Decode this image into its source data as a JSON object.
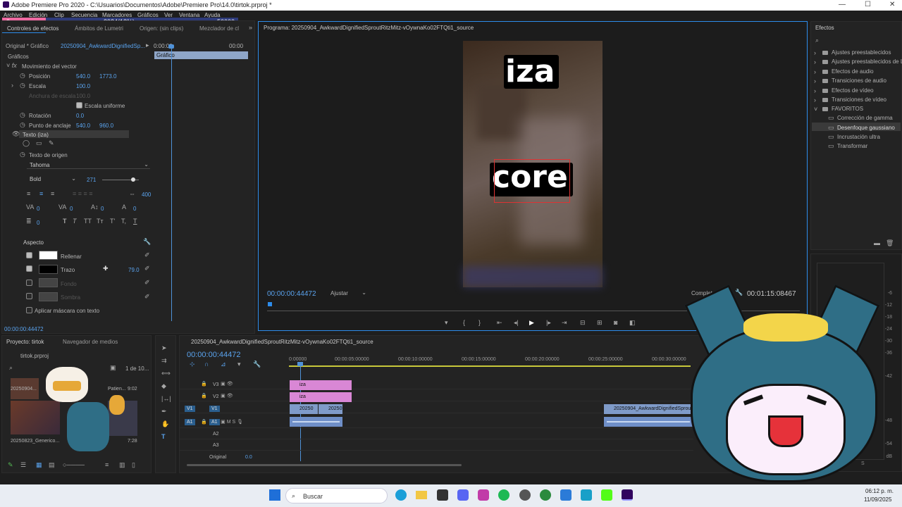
{
  "window": {
    "title": "Adobe Premiere Pro 2020 - C:\\Usuarios\\Documentos\\Adobe\\Premiere Pro\\14.0\\tirtok.prproj *"
  },
  "overlay": {
    "left_value": "0",
    "mid_value": "8984(18%)",
    "right_value": "50000"
  },
  "menu": [
    "Archivo",
    "Edición",
    "Clip",
    "Secuencia",
    "Marcadores",
    "Gráficos",
    "Ver",
    "Ventana",
    "Ayuda"
  ],
  "effect_controls": {
    "tabs": [
      "Controles de efectos",
      "Ámbitos de Lumetri",
      "Origen: (sin clips)",
      "Mezclador de cl"
    ],
    "source": "Original * Gráfico",
    "sequence": "20250904_AwkwardDignifiedSp...",
    "timecode_start": "0:00:00",
    "timecode_end": "00:00",
    "clip_label": "Gráfico",
    "section": "Gráficos",
    "vector_motion": "Movimiento del vector",
    "position_label": "Posición",
    "position_x": "540.0",
    "position_y": "1773.0",
    "scale_label": "Escala",
    "scale_value": "100.0",
    "scale_width_label": "Anchura de escala",
    "scale_width_value": "100.0",
    "uniform_scale": "Escala uniforme",
    "rotation_label": "Rotación",
    "rotation_value": "0.0",
    "anchor_label": "Punto de anclaje",
    "anchor_x": "540.0",
    "anchor_y": "960.0",
    "text_layer": "Texto (iza)",
    "source_text": "Texto de origen",
    "font": "Tahoma",
    "font_style": "Bold",
    "font_size": "271",
    "tracking_value": "400",
    "kerning": [
      "0",
      "0",
      "0",
      "0",
      "0"
    ],
    "text_styles": [
      "T",
      "T",
      "TT",
      "Tт",
      "T'",
      "T,",
      "T"
    ],
    "appearance": "Aspecto",
    "fill_label": "Rellenar",
    "stroke_label": "Trazo",
    "stroke_value": "79.0",
    "background_label": "Fondo",
    "shadow_label": "Sombra",
    "mask_label": "Aplicar máscara con texto",
    "footer_timecode": "00:00:00:44472"
  },
  "program": {
    "title": "Programa: 20250904_AwkwardDignifiedSproutRitzMitz-vOywnaKo02FTQti1_source",
    "text_top": "iza",
    "text_bottom": "core",
    "timecode_left": "00:00:00:44472",
    "fit": "Ajustar",
    "quality": "Completa",
    "timecode_right": "00:01:15:08467"
  },
  "project": {
    "tab_project": "Proyecto: tirtok",
    "tab_media": "Navegador de medios",
    "file": "tirtok.prproj",
    "count": "1 de 10...",
    "item1": "20250904...",
    "item1_meta": "Patien...",
    "item1_dur": "9:02",
    "item2": "20250823_Generico...",
    "item2_dur": "7:28"
  },
  "timeline": {
    "title": "20250904_AwkwardDignifiedSproutRitzMitz-vOywnaKo02FTQti1_source",
    "timecode": "00:00:00:44472",
    "ruler": [
      "0:00000",
      "00:00:05:00000",
      "00:00:10:00000",
      "00:00:15:00000",
      "00:00:20:00000",
      "00:00:25:00000",
      "00:00:30:00000"
    ],
    "tracks": [
      "V3",
      "V2",
      "V1",
      "A1",
      "A2",
      "A3"
    ],
    "src_v1": "V1",
    "src_a1": "A1",
    "clips": {
      "v3": "iza",
      "v2": "iza",
      "v1a": "20250",
      "v1b": "20250",
      "v1c": "20250904_AwkwardDignifiedSprout",
      "a1": ""
    },
    "original": "Original",
    "original_value": "0.0"
  },
  "effects": {
    "title": "Efectos",
    "items": [
      "Ajustes preestablecidos",
      "Ajustes preestablecidos de L",
      "Efectos de audio",
      "Transiciones de audio",
      "Efectos de vídeo",
      "Transiciones de vídeo",
      "FAVORITOS"
    ],
    "favorites": [
      "Corrección de gamma",
      "Desenfoque gaussiano",
      "Incrustación ultra",
      "Transformar"
    ]
  },
  "meters": [
    "-6",
    "-12",
    "-18",
    "-24",
    "-30",
    "-36",
    "-42",
    "-48",
    "-54",
    "dB"
  ],
  "meter_footer": [
    "S",
    "S"
  ],
  "taskbar": {
    "search": "Buscar",
    "time": "06:12 p. m.",
    "date": "11/09/2025"
  },
  "colors": {
    "accent": "#2d8ceb",
    "clip_pink": "#d987d5",
    "clip_blue": "#6f8fc8",
    "video_bg": "#2f2a20"
  }
}
